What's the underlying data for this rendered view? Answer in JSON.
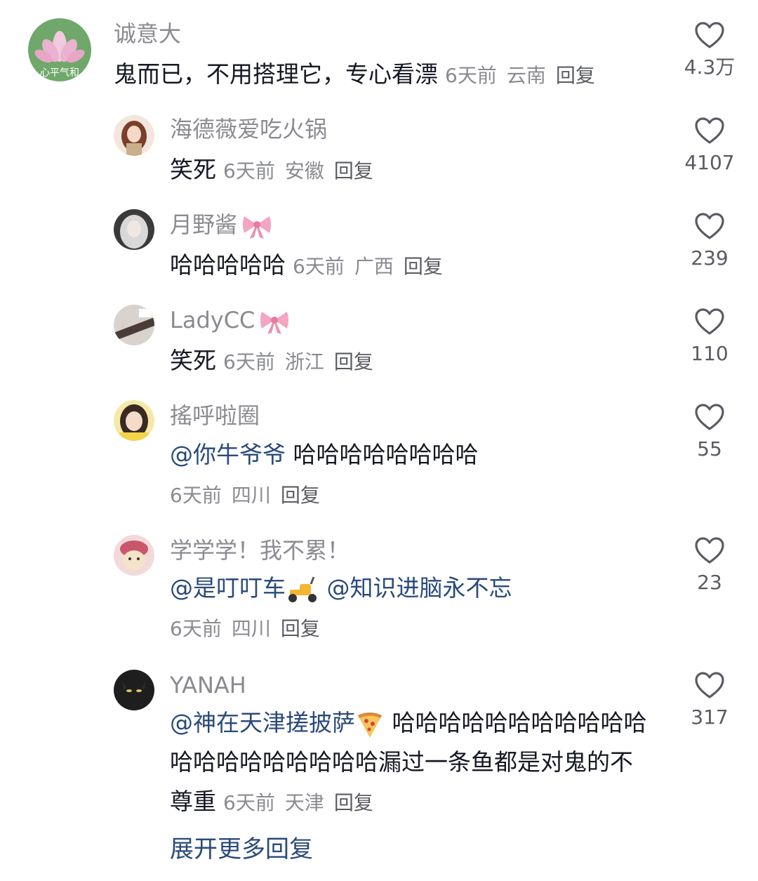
{
  "comments": [
    {
      "username": "诚意大",
      "text": "鬼而已，不用搭理它，专心看漂",
      "time": "6天前",
      "location": "云南",
      "reply": "回复",
      "likes": "4.3万"
    },
    {
      "username": "海德薇爱吃火锅",
      "text": "笑死",
      "time": "6天前",
      "location": "安徽",
      "reply": "回复",
      "likes": "4107"
    },
    {
      "username": "月野酱",
      "text": "哈哈哈哈哈",
      "time": "6天前",
      "location": "广西",
      "reply": "回复",
      "likes": "239"
    },
    {
      "username": "LadyCC",
      "text": "笑死",
      "time": "6天前",
      "location": "浙江",
      "reply": "回复",
      "likes": "110"
    },
    {
      "username": "搖呼啦圈",
      "mention": "@你牛爷爷",
      "text": "哈哈哈哈哈哈哈哈",
      "time": "6天前",
      "location": "四川",
      "reply": "回复",
      "likes": "55"
    },
    {
      "username": "学学学！我不累！",
      "mention": "@是叮叮车",
      "mention2": "@知识进脑永不忘",
      "time": "6天前",
      "location": "四川",
      "reply": "回复",
      "likes": "23"
    },
    {
      "username": "YANAH",
      "mention": "@神在天津搓披萨",
      "text": "哈哈哈哈哈哈哈哈哈哈哈哈哈哈哈哈哈哈哈哈漏过一条鱼都是对鬼的不尊重",
      "time": "6天前",
      "location": "天津",
      "reply": "回复",
      "likes": "317"
    }
  ],
  "expand_more": "展开更多回复",
  "avatar0_text": "心平气和",
  "colors": {
    "mention": "#2a4a7a",
    "meta": "#8a8b91",
    "text": "#161823"
  }
}
